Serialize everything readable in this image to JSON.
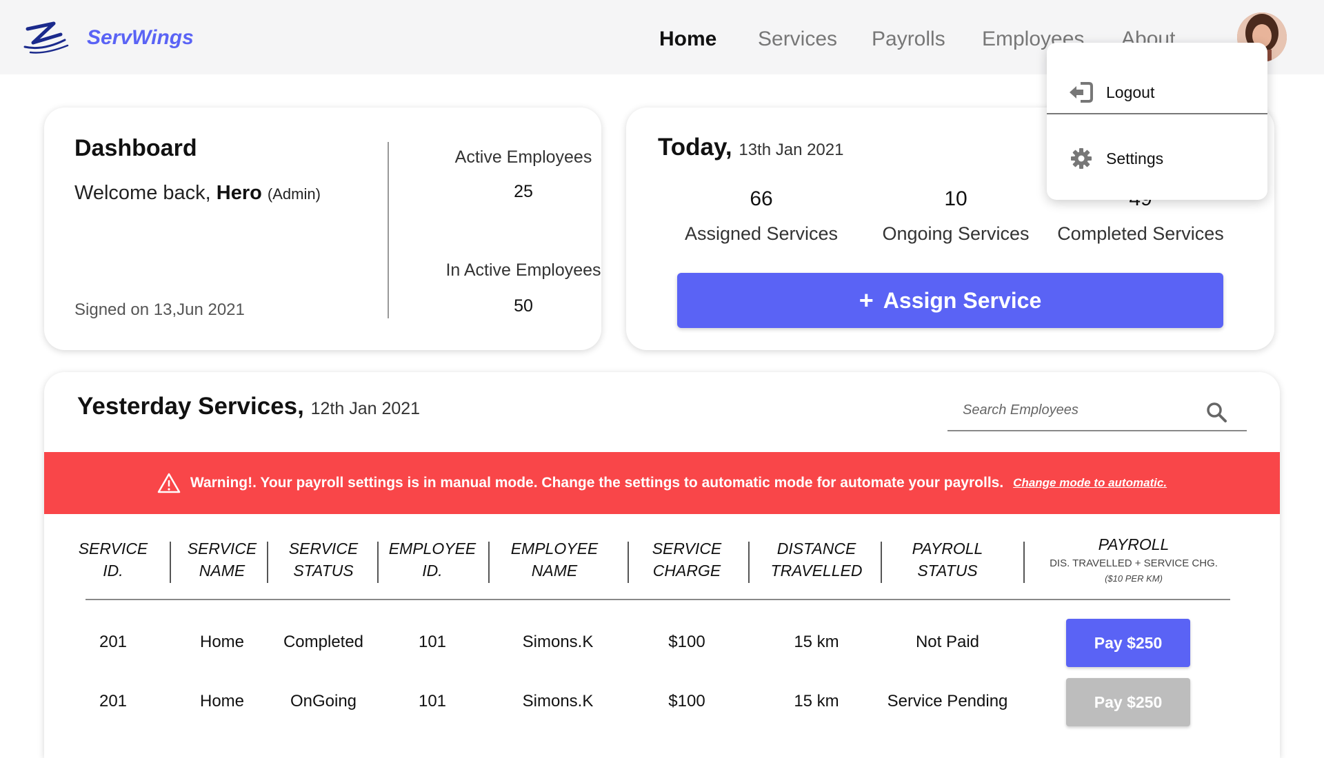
{
  "brand": {
    "name": "ServWings"
  },
  "nav": [
    {
      "label": "Home",
      "active": true
    },
    {
      "label": "Services",
      "active": false
    },
    {
      "label": "Payrolls",
      "active": false
    },
    {
      "label": "Employees",
      "active": false
    },
    {
      "label": "About",
      "active": false
    }
  ],
  "user_menu": {
    "items": [
      {
        "label": "Logout",
        "icon": "logout-icon"
      },
      {
        "label": "Settings",
        "icon": "gear-icon"
      }
    ]
  },
  "dashboard": {
    "title": "Dashboard",
    "welcome_prefix": "Welcome back,",
    "user_name": "Hero",
    "role": "(Admin)",
    "signed": "Signed on 13,Jun 2021",
    "active_label": "Active Employees",
    "active_value": "25",
    "inactive_label": "In Active Employees",
    "inactive_value": "50"
  },
  "today": {
    "title": "Today,",
    "date": "13th Jan 2021",
    "stats": [
      {
        "value": "66",
        "label": "Assigned Services"
      },
      {
        "value": "10",
        "label": "Ongoing Services"
      },
      {
        "value": "49",
        "label": "Completed Services"
      }
    ],
    "assign_label": "Assign Service"
  },
  "yesterday": {
    "title": "Yesterday Services,",
    "date": "12th Jan 2021",
    "search_placeholder": "Search Employees",
    "warning_text": "Warning!. Your payroll settings is in manual mode.  Change the settings to automatic mode for automate your payrolls.",
    "warning_link": "Change mode to automatic.",
    "headers": [
      [
        "SERVICE",
        "ID."
      ],
      [
        "SERVICE",
        "NAME"
      ],
      [
        "SERVICE",
        "STATUS"
      ],
      [
        "EMPLOYEE",
        "ID."
      ],
      [
        "EMPLOYEE",
        "NAME"
      ],
      [
        "SERVICE",
        "CHARGE"
      ],
      [
        "DISTANCE",
        "TRAVELLED"
      ],
      [
        "PAYROLL",
        "STATUS"
      ]
    ],
    "payroll_header": {
      "title": "PAYROLL",
      "sub": "DIS. TRAVELLED + SERVICE CHG.",
      "note": "($10 PER KM)"
    },
    "rows": [
      {
        "service_id": "201",
        "service_name": "Home",
        "status": "Completed",
        "emp_id": "101",
        "emp_name": "Simons.K",
        "charge": "$100",
        "distance": "15 km",
        "payroll_status": "Not Paid",
        "pay_label": "Pay $250",
        "pay_enabled": true
      },
      {
        "service_id": "201",
        "service_name": "Home",
        "status": "OnGoing",
        "emp_id": "101",
        "emp_name": "Simons.K",
        "charge": "$100",
        "distance": "15 km",
        "payroll_status": "Service Pending",
        "pay_label": "Pay $250",
        "pay_enabled": false
      }
    ]
  },
  "colors": {
    "accent": "#5a63f5",
    "warning": "#f94649",
    "disabled": "#bdbdbd"
  }
}
